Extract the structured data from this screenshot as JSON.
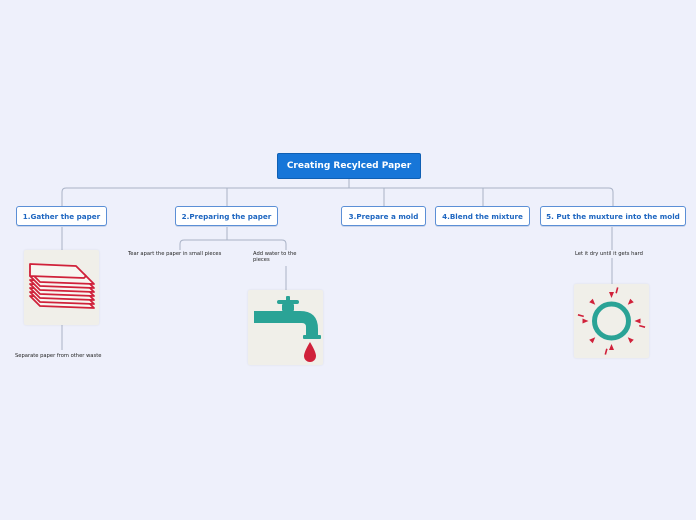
{
  "title": "Creating Recylced Paper",
  "branches": [
    {
      "label": "1.Gather the paper"
    },
    {
      "label": "2.Preparing the paper"
    },
    {
      "label": "3.Prepare a mold"
    },
    {
      "label": "4.Blend the mixture"
    },
    {
      "label": "5. Put the muxture into the mold"
    }
  ],
  "leaves": {
    "separate": "Separate paper from other waste",
    "tear": "Tear apart  the paper in small pieces",
    "water": "Add water to the pieces",
    "dry": "Let it dry until it gets hard"
  },
  "icons": {
    "paper": "paper-stack-icon",
    "faucet": "water-faucet-icon",
    "sun": "sun-icon"
  },
  "colors": {
    "root": "#1776d8",
    "branch_text": "#1e66c0",
    "connector": "#a9b2c6",
    "icon_red": "#d0213a",
    "icon_teal": "#2aa396"
  }
}
